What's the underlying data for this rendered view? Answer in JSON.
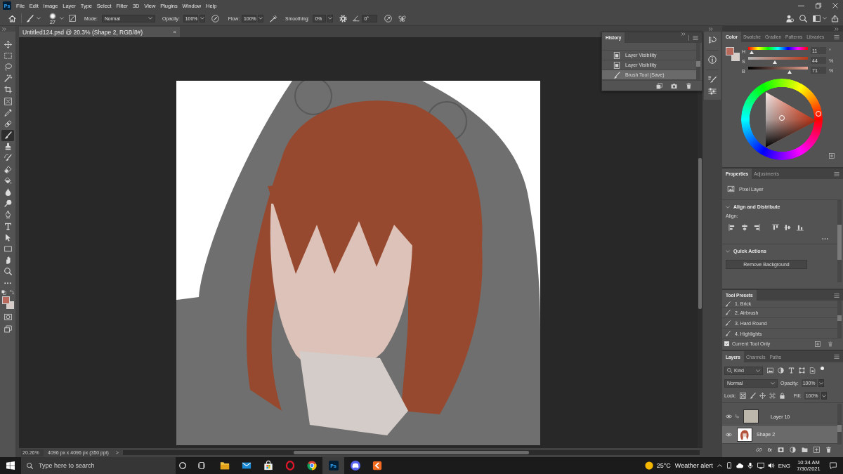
{
  "app": {
    "logo": "Ps"
  },
  "menu_bar": {
    "items": [
      "File",
      "Edit",
      "Image",
      "Layer",
      "Type",
      "Select",
      "Filter",
      "3D",
      "View",
      "Plugins",
      "Window",
      "Help"
    ]
  },
  "options_bar": {
    "brush_size": "27",
    "mode_label": "Mode:",
    "mode": "Normal",
    "opacity_label": "Opacity:",
    "opacity": "100%",
    "flow_label": "Flow:",
    "flow": "100%",
    "smoothing_label": "Smoothing:",
    "smoothing": "0%",
    "angle": "0°"
  },
  "toolbar": {
    "tools": [
      {
        "selected": false
      },
      {
        "selected": false
      },
      {
        "selected": false
      },
      {
        "selected": false
      },
      {
        "selected": false
      },
      {
        "selected": false
      },
      {
        "selected": false
      },
      {
        "selected": false
      },
      {
        "selected": true
      },
      {
        "selected": false
      },
      {
        "selected": false
      },
      {
        "selected": false
      },
      {
        "selected": false
      },
      {
        "selected": false
      },
      {
        "selected": false
      },
      {
        "selected": false
      },
      {
        "selected": false
      },
      {
        "selected": false
      },
      {
        "selected": false
      },
      {
        "selected": false
      },
      {
        "selected": false
      },
      {
        "selected": false
      }
    ],
    "swatches": [
      {
        "kind": "foreground",
        "color": "#b9695b"
      },
      {
        "kind": "background",
        "color": "#d7ccc7"
      }
    ]
  },
  "document_tab": {
    "title": "Untitled124.psd @ 20.3% (Shape 2, RGB/8#)",
    "close": "×"
  },
  "status_bar": {
    "zoom": "20.26%",
    "document_size": "4096 px x 4096 px (350 ppi)",
    "arrow": ">"
  },
  "history_panel": {
    "title": "History",
    "rows": [
      {
        "kind": "layer",
        "label": "Layer Visibility",
        "selected": false
      },
      {
        "kind": "layer",
        "label": "Layer Visibility",
        "selected": false
      },
      {
        "kind": "brush",
        "label": "Brush Tool (Save)",
        "selected": true
      }
    ]
  },
  "color_panel": {
    "tabs": [
      {
        "label": "Color",
        "selected": true
      },
      {
        "label": "Swatche",
        "selected": false
      },
      {
        "label": "Gradien",
        "selected": false
      },
      {
        "label": "Patterns",
        "selected": false
      },
      {
        "label": "Libraries",
        "selected": false
      }
    ],
    "swatches": [
      {
        "kind": "foreground",
        "color": "#b9695b"
      },
      {
        "kind": "background",
        "color": "#d7ccc7"
      }
    ],
    "sliders": [
      {
        "kind": "hue",
        "label": "H",
        "value": "11",
        "unit": "°",
        "level": 0.03
      },
      {
        "kind": "saturation",
        "label": "S",
        "value": "44",
        "unit": "%",
        "level": 0.44
      },
      {
        "kind": "brightness",
        "label": "B",
        "value": "71",
        "unit": "%",
        "level": 0.71
      }
    ]
  },
  "properties_panel": {
    "tabs": [
      {
        "label": "Properties",
        "selected": true
      },
      {
        "label": "Adjustments",
        "selected": false
      }
    ],
    "layer_type": "Pixel Layer",
    "sections": [
      {
        "kind": "align",
        "title": "Align and Distribute",
        "expanded": true,
        "label": "Align:"
      },
      {
        "kind": "quick_actions",
        "title": "Quick Actions",
        "expanded": true,
        "button": "Remove Background"
      }
    ]
  },
  "tool_presets_panel": {
    "tabs": [
      {
        "label": "Tool Presets",
        "selected": true
      }
    ],
    "presets": [
      {
        "label": "1. Brick"
      },
      {
        "label": "2. Airbrush"
      },
      {
        "label": "3. Hard Round"
      },
      {
        "label": "4. Highlights"
      }
    ],
    "current_tool_only": {
      "label": "Current Tool Only",
      "checked": true
    }
  },
  "layers_panel": {
    "tabs": [
      {
        "label": "Layers",
        "selected": true
      },
      {
        "label": "Channels",
        "selected": false
      },
      {
        "label": "Paths",
        "selected": false
      }
    ],
    "filter": "Kind",
    "blend_mode": "Normal",
    "opacity_label": "Opacity:",
    "opacity": "100%",
    "lock_label": "Lock:",
    "fill_label": "Fill:",
    "fill": "100%",
    "layers": [
      {
        "name": "Layer 10",
        "kind": "fill",
        "clipped": true,
        "visible": true,
        "selected": false
      },
      {
        "name": "Shape 2",
        "kind": "art",
        "clipped": false,
        "visible": true,
        "selected": true
      }
    ],
    "style_button": "fx"
  },
  "taskbar": {
    "search_placeholder": "Type here to search",
    "apps": [
      {
        "selected": false
      },
      {
        "selected": false
      },
      {
        "selected": false
      },
      {
        "selected": false
      },
      {
        "selected": false
      },
      {
        "selected": true,
        "label": "Ps"
      },
      {
        "selected": false
      },
      {
        "selected": false
      }
    ],
    "weather_temperature": "25°C",
    "weather_text": "Weather alert",
    "language": "ENG",
    "time": "10:34 AM",
    "date": "7/30/2021"
  }
}
